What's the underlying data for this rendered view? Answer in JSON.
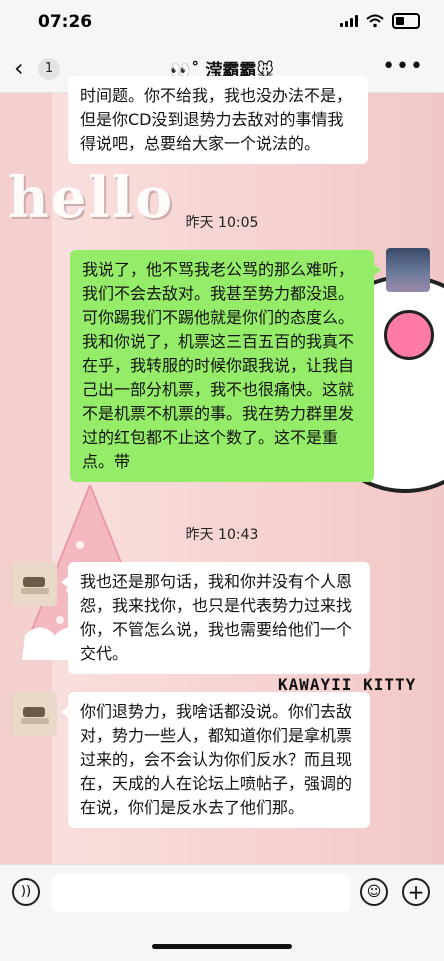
{
  "status_bar": {
    "time": "07:26"
  },
  "nav": {
    "back_icon": "chevron-left",
    "unread_count": "1",
    "title": "👀˚ 滢霸霸🐭",
    "more_icon": "ellipsis"
  },
  "background": {
    "hello_text": "hello",
    "kawaii_text": "KAWAYII KITTY"
  },
  "messages": [
    {
      "type": "other",
      "text": "时间题。你不给我，我也没办法不是，但是你CD没到退势力去敌对的事情我得说吧，总要给大家一个说法的。"
    },
    {
      "type": "time",
      "text": "昨天 10:05"
    },
    {
      "type": "self",
      "text": "我说了，他不骂我老公骂的那么难听，我们不会去敌对。我甚至势力都没退。可你踢我们不踢他就是你们的态度么。我和你说了，机票这三百五百的我真不在乎，我转服的时候你跟我说，让我自己出一部分机票，我不也很痛快。这就不是机票不机票的事。我在势力群里发过的红包都不止这个数了。这不是重点。带"
    },
    {
      "type": "time",
      "text": "昨天 10:43"
    },
    {
      "type": "other",
      "text": "我也还是那句话，我和你并没有个人恩怨，我来找你，也只是代表势力过来找你，不管怎么说，我也需要给他们一个交代。"
    },
    {
      "type": "other",
      "text": "你们退势力，我啥话都没说。你们去敌对，势力一些人，都知道你们是拿机票过来的，会不会认为你们反水？而且现在，天成的人在论坛上喷帖子，强调的在说，你们是反水去了他们那。"
    }
  ],
  "input_bar": {
    "voice_icon": "voice",
    "emoji_icon": "smiley",
    "plus_icon": "plus"
  }
}
